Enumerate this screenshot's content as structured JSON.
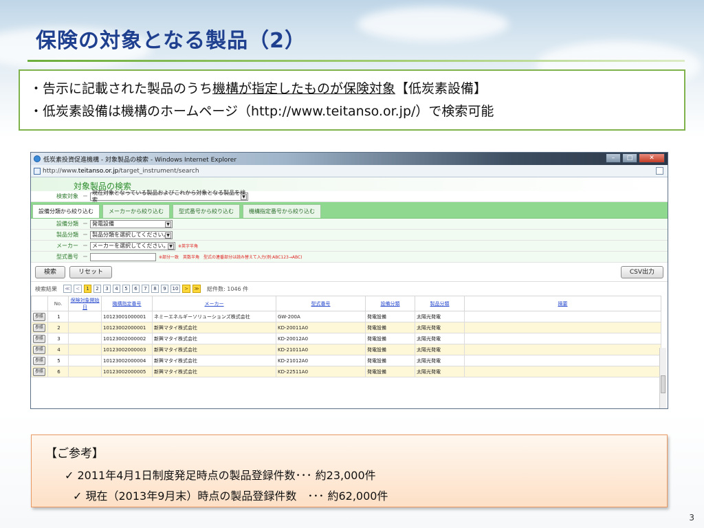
{
  "slide": {
    "title": "保険の対象となる製品（2）",
    "page_number": "3"
  },
  "notice": {
    "line1_prefix": "・告示に記載された製品のうち",
    "line1_underlined": "機構が指定したものが保険対象",
    "line1_suffix": "【低炭素設備】",
    "line2": "・低炭素設備は機構のホームページ（http://www.teitanso.or.jp/）で検索可能"
  },
  "browser": {
    "window_title": "低炭素投資促進機構 - 対象製品の検索 - Windows Internet Explorer",
    "url_prefix": "http://www.",
    "url_domain": "teitanso.or.jp",
    "url_path": "/target_instrument/search",
    "site_title": "対象製品の検索",
    "search_target_label": "検索対象",
    "search_target_value": "現在対象となっている製品およびこれから対象となる製品を検索",
    "tabs": [
      {
        "label": "設備分類から絞り込む",
        "active": true
      },
      {
        "label": "メーカーから絞り込む",
        "active": false
      },
      {
        "label": "型式番号から絞り込む",
        "active": false
      },
      {
        "label": "機構指定番号から絞り込む",
        "active": false
      }
    ],
    "filters": {
      "equipment_label": "設備分類",
      "equipment_value": "発電設備",
      "product_label": "製品分類",
      "product_value": "製品分類を選択してください。",
      "maker_label": "メーカー",
      "maker_value": "メーカーを選択してください。",
      "maker_note": "※英字半角",
      "model_label": "型式番号",
      "model_note": "※部分一致　英数半角　型式の連番部分は読み替えて入力(例:ABC123→ABC)"
    },
    "buttons": {
      "search": "検索",
      "reset": "リセット",
      "csv": "CSV出力"
    },
    "pager": {
      "label": "検索結果",
      "first": "≪",
      "prev": "<",
      "pages": [
        "1",
        "2",
        "3",
        "4",
        "5",
        "6",
        "7",
        "8",
        "9",
        "10"
      ],
      "current": "1",
      "next": ">",
      "last": "≫",
      "total": "総件数: 1046 件"
    },
    "table": {
      "headers": [
        "",
        "No.",
        "保険対象開始日",
        "機構指定番号",
        "メーカー",
        "型式番号",
        "設備分類",
        "製品分類",
        "摘要"
      ],
      "ref_label": "参照",
      "rows": [
        [
          "1",
          "",
          "10123001000001",
          "ネミーエネルギーソリューションズ株式会社",
          "GW-200A",
          "発電設備",
          "太陽光発電",
          ""
        ],
        [
          "2",
          "",
          "10123002000001",
          "新興マタイ株式会社",
          "KD-20011A0",
          "発電設備",
          "太陽光発電",
          ""
        ],
        [
          "3",
          "",
          "10123002000002",
          "新興マタイ株式会社",
          "KD-20012A0",
          "発電設備",
          "太陽光発電",
          ""
        ],
        [
          "4",
          "",
          "10123002000003",
          "新興マタイ株式会社",
          "KD-21011A0",
          "発電設備",
          "太陽光発電",
          ""
        ],
        [
          "5",
          "",
          "10123002000004",
          "新興マタイ株式会社",
          "KD-21012A0",
          "発電設備",
          "太陽光発電",
          ""
        ],
        [
          "6",
          "",
          "10123002000005",
          "新興マタイ株式会社",
          "KD-22511A0",
          "発電設備",
          "太陽光発電",
          ""
        ]
      ]
    }
  },
  "reference": {
    "title": "【ご参考】",
    "line1": "✓ 2011年4月1日制度発足時点の製品登録件数･･･ 約23,000件",
    "line2": "✓ 現在（2013年9月末）時点の製品登録件数　･･･ 約62,000件"
  },
  "colors": {
    "title": "#1f3f8f",
    "accent_green": "#8fd88f",
    "reference_border": "#e89860"
  }
}
